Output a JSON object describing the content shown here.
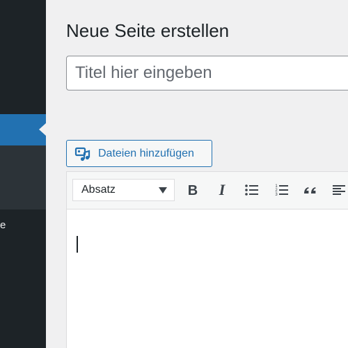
{
  "page": {
    "title": "Neue Seite erstellen"
  },
  "sidebar": {
    "active_item_label": "",
    "truncated_label": "e"
  },
  "title_field": {
    "placeholder": "Titel hier eingeben",
    "value": ""
  },
  "media_button": {
    "label": "Dateien hinzufügen",
    "icon": "add-media-icon"
  },
  "toolbar": {
    "format_select": {
      "selected": "Absatz"
    },
    "buttons": [
      {
        "name": "bold",
        "icon": "bold-icon"
      },
      {
        "name": "italic",
        "icon": "italic-icon"
      },
      {
        "name": "bulleted-list",
        "icon": "bulleted-list-icon"
      },
      {
        "name": "numbered-list",
        "icon": "numbered-list-icon"
      },
      {
        "name": "blockquote",
        "icon": "quote-icon"
      },
      {
        "name": "align-left",
        "icon": "align-left-icon"
      }
    ]
  },
  "editor": {
    "content": ""
  },
  "colors": {
    "sidebar_bg": "#1d2327",
    "sidebar_active": "#2271b1",
    "sidebar_sub": "#2c3338",
    "accent": "#2271b1",
    "page_bg": "#f0f0f1"
  }
}
